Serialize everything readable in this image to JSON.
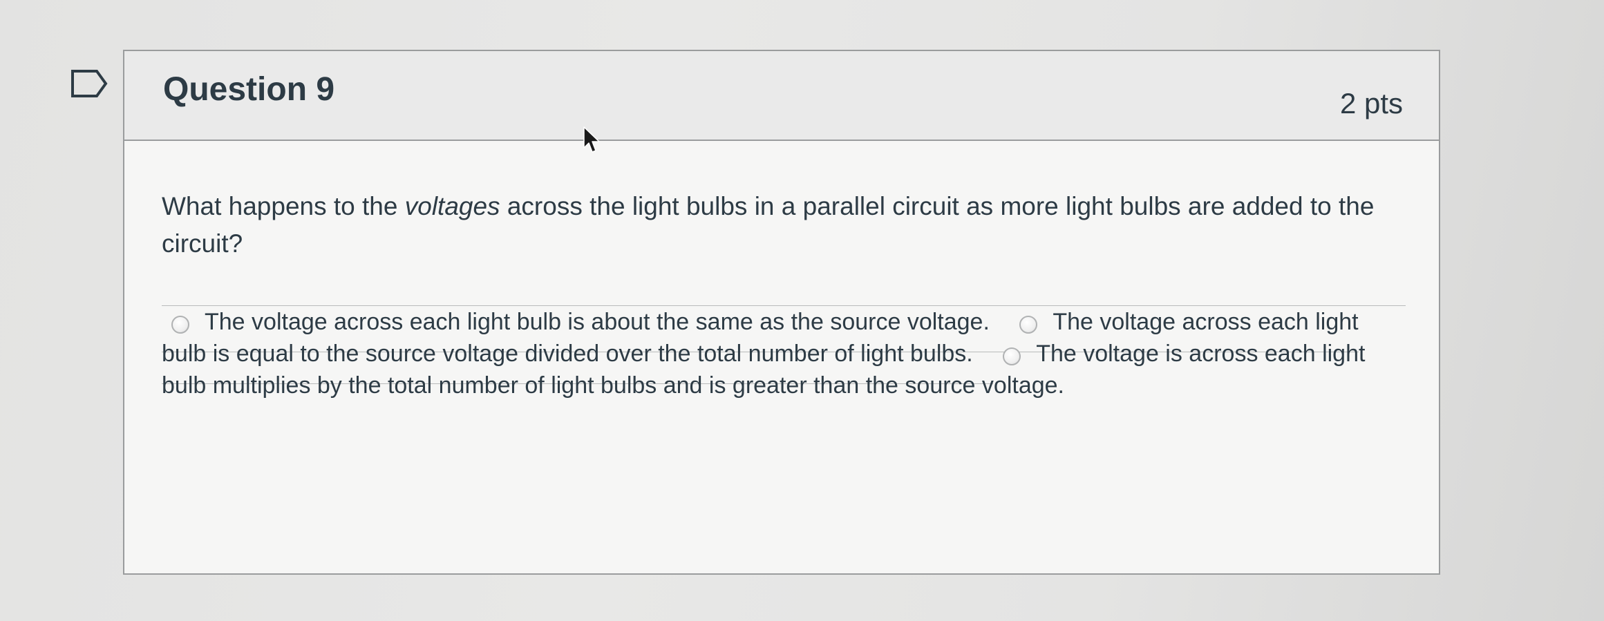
{
  "question": {
    "title": "Question 9",
    "points": "2 pts",
    "prompt_before": "What happens to the ",
    "prompt_emphasis": "voltages",
    "prompt_after": " across the light bulbs in a parallel circuit as more light bulbs are added to the circuit?",
    "answers": [
      {
        "label": "The voltage across each light bulb is about the same as the source voltage."
      },
      {
        "label": "The voltage across each light bulb is equal to the source voltage divided over the total number of light bulbs."
      },
      {
        "label": "The voltage is across each light bulb multiplies by the total number of light bulbs and is greater than the source voltage."
      }
    ]
  },
  "icons": {
    "flag": "bookmark-flag-icon",
    "cursor": "mouse-pointer-icon",
    "radio": "radio-button"
  },
  "colors": {
    "text": "#2d3b45",
    "border": "#9a9c9d",
    "header_bg": "#eaeaea",
    "card_bg": "#f6f6f5"
  }
}
